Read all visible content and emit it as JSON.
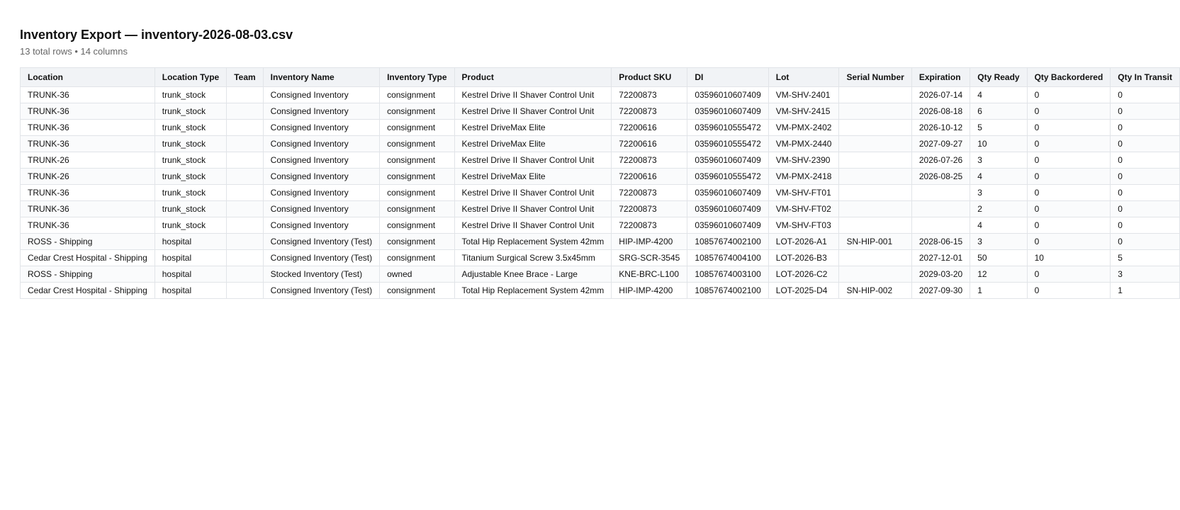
{
  "header": {
    "title": "Inventory Export — inventory-2026-08-03.csv",
    "subtitle": "13 total rows • 14 columns"
  },
  "table": {
    "columns": [
      "Location",
      "Location Type",
      "Team",
      "Inventory Name",
      "Inventory Type",
      "Product",
      "Product SKU",
      "DI",
      "Lot",
      "Serial Number",
      "Expiration",
      "Qty Ready",
      "Qty Backordered",
      "Qty In Transit"
    ],
    "rows": [
      [
        "TRUNK-36",
        "trunk_stock",
        "",
        "Consigned Inventory",
        "consignment",
        "Kestrel Drive II Shaver Control Unit",
        "72200873",
        "03596010607409",
        "VM-SHV-2401",
        "",
        "2026-07-14",
        "4",
        "0",
        "0"
      ],
      [
        "TRUNK-36",
        "trunk_stock",
        "",
        "Consigned Inventory",
        "consignment",
        "Kestrel Drive II Shaver Control Unit",
        "72200873",
        "03596010607409",
        "VM-SHV-2415",
        "",
        "2026-08-18",
        "6",
        "0",
        "0"
      ],
      [
        "TRUNK-36",
        "trunk_stock",
        "",
        "Consigned Inventory",
        "consignment",
        "Kestrel DriveMax Elite",
        "72200616",
        "03596010555472",
        "VM-PMX-2402",
        "",
        "2026-10-12",
        "5",
        "0",
        "0"
      ],
      [
        "TRUNK-36",
        "trunk_stock",
        "",
        "Consigned Inventory",
        "consignment",
        "Kestrel DriveMax Elite",
        "72200616",
        "03596010555472",
        "VM-PMX-2440",
        "",
        "2027-09-27",
        "10",
        "0",
        "0"
      ],
      [
        "TRUNK-26",
        "trunk_stock",
        "",
        "Consigned Inventory",
        "consignment",
        "Kestrel Drive II Shaver Control Unit",
        "72200873",
        "03596010607409",
        "VM-SHV-2390",
        "",
        "2026-07-26",
        "3",
        "0",
        "0"
      ],
      [
        "TRUNK-26",
        "trunk_stock",
        "",
        "Consigned Inventory",
        "consignment",
        "Kestrel DriveMax Elite",
        "72200616",
        "03596010555472",
        "VM-PMX-2418",
        "",
        "2026-08-25",
        "4",
        "0",
        "0"
      ],
      [
        "TRUNK-36",
        "trunk_stock",
        "",
        "Consigned Inventory",
        "consignment",
        "Kestrel Drive II Shaver Control Unit",
        "72200873",
        "03596010607409",
        "VM-SHV-FT01",
        "",
        "",
        "3",
        "0",
        "0"
      ],
      [
        "TRUNK-36",
        "trunk_stock",
        "",
        "Consigned Inventory",
        "consignment",
        "Kestrel Drive II Shaver Control Unit",
        "72200873",
        "03596010607409",
        "VM-SHV-FT02",
        "",
        "",
        "2",
        "0",
        "0"
      ],
      [
        "TRUNK-36",
        "trunk_stock",
        "",
        "Consigned Inventory",
        "consignment",
        "Kestrel Drive II Shaver Control Unit",
        "72200873",
        "03596010607409",
        "VM-SHV-FT03",
        "",
        "",
        "4",
        "0",
        "0"
      ],
      [
        "ROSS - Shipping",
        "hospital",
        "",
        "Consigned Inventory (Test)",
        "consignment",
        "Total Hip Replacement System 42mm",
        "HIP-IMP-4200",
        "10857674002100",
        "LOT-2026-A1",
        "SN-HIP-001",
        "2028-06-15",
        "3",
        "0",
        "0"
      ],
      [
        "Cedar Crest Hospital - Shipping",
        "hospital",
        "",
        "Consigned Inventory (Test)",
        "consignment",
        "Titanium Surgical Screw 3.5x45mm",
        "SRG-SCR-3545",
        "10857674004100",
        "LOT-2026-B3",
        "",
        "2027-12-01",
        "50",
        "10",
        "5"
      ],
      [
        "ROSS - Shipping",
        "hospital",
        "",
        "Stocked Inventory (Test)",
        "owned",
        "Adjustable Knee Brace - Large",
        "KNE-BRC-L100",
        "10857674003100",
        "LOT-2026-C2",
        "",
        "2029-03-20",
        "12",
        "0",
        "3"
      ],
      [
        "Cedar Crest Hospital - Shipping",
        "hospital",
        "",
        "Consigned Inventory (Test)",
        "consignment",
        "Total Hip Replacement System 42mm",
        "HIP-IMP-4200",
        "10857674002100",
        "LOT-2025-D4",
        "SN-HIP-002",
        "2027-09-30",
        "1",
        "0",
        "1"
      ]
    ]
  }
}
